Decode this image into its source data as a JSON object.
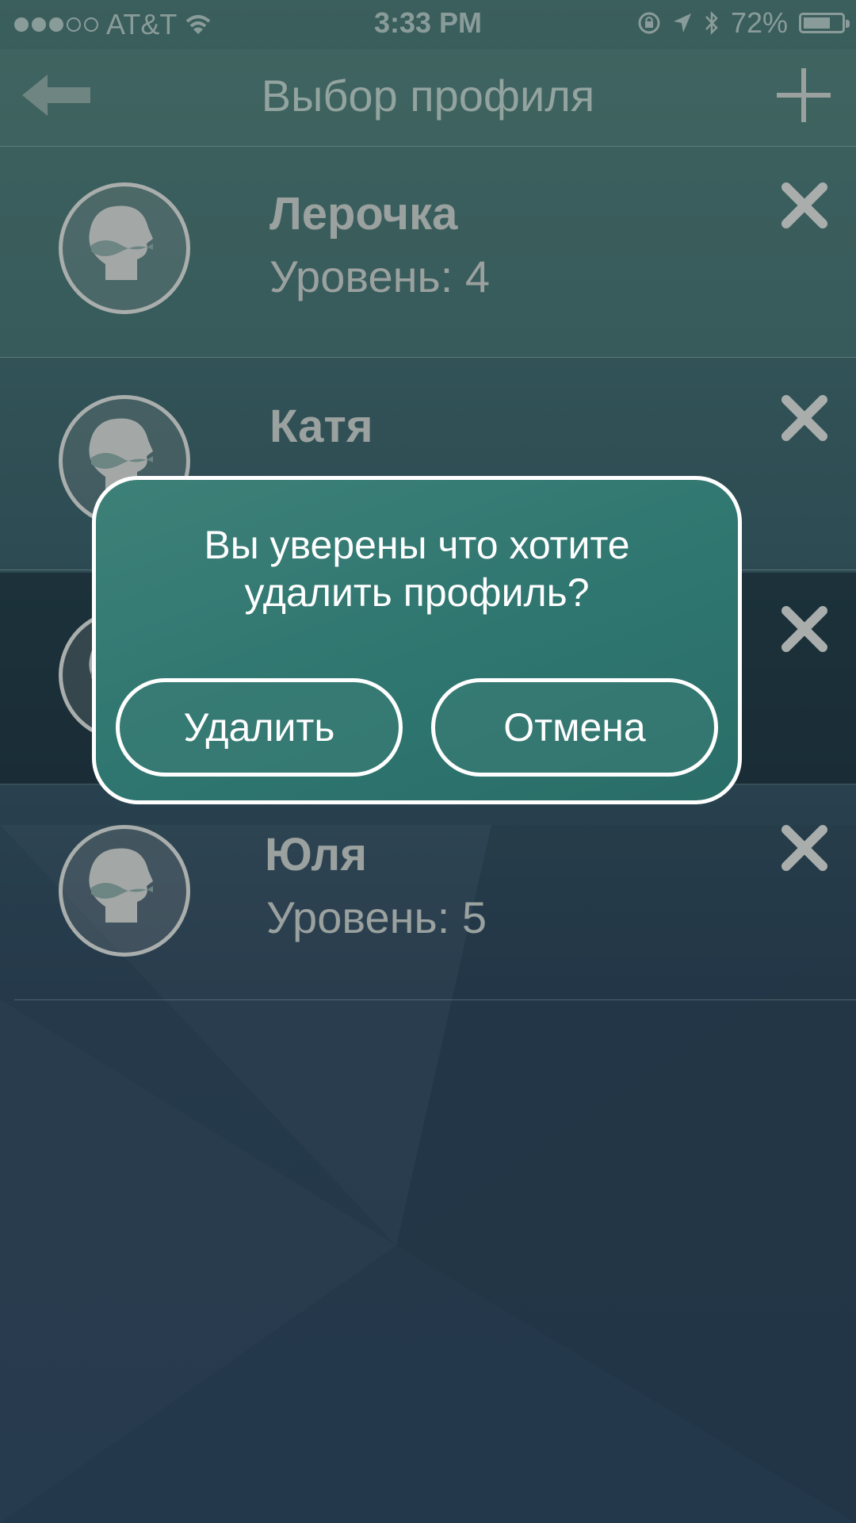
{
  "status_bar": {
    "carrier": "AT&T",
    "time": "3:33 PM",
    "battery": "72%",
    "battery_level": 0.72,
    "signal_bars": 3,
    "icons": [
      "wifi-icon",
      "rotation-lock-icon",
      "location-icon",
      "bluetooth-icon",
      "battery-icon"
    ]
  },
  "nav": {
    "title": "Выбор профиля",
    "back_icon": "back-arrow-icon",
    "add_icon": "plus-icon"
  },
  "profiles": [
    {
      "name": "Лерочка",
      "level": "Уровень: 4"
    },
    {
      "name": "Катя",
      "level": ""
    },
    {
      "name": "",
      "level": ""
    },
    {
      "name": "Юля",
      "level": "Уровень: 5"
    }
  ],
  "dialog": {
    "message_line1": "Вы уверены что хотите",
    "message_line2": "удалить профиль?",
    "confirm_label": "Удалить",
    "cancel_label": "Отмена"
  },
  "colors": {
    "dialog_bg": "#2f7670",
    "dialog_border": "#ffffff",
    "muted_text": "#9aa19f"
  }
}
